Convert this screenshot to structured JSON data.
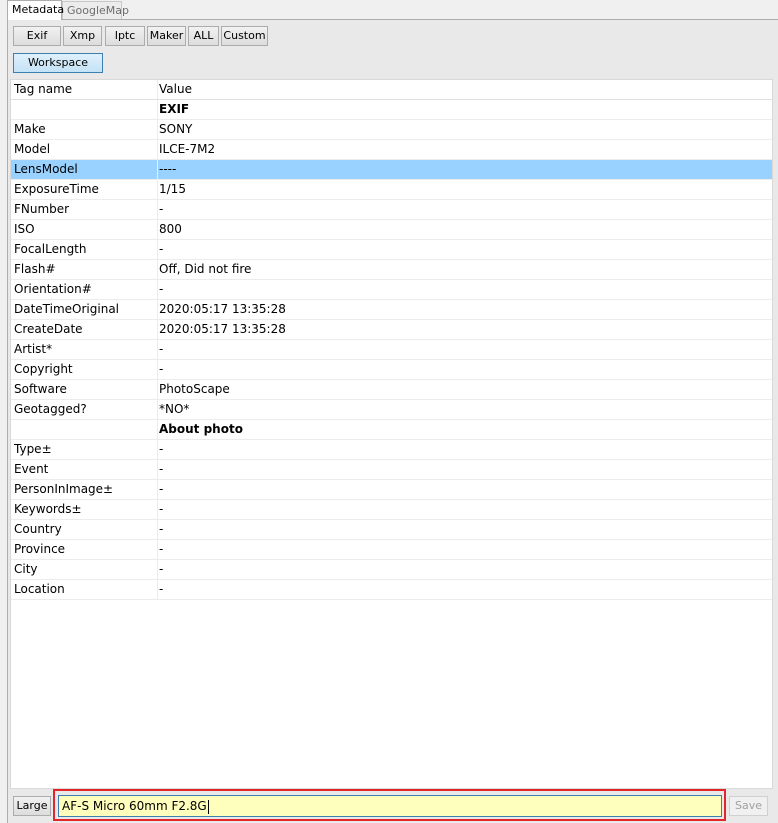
{
  "tabs": [
    {
      "label": "Metadata",
      "active": true
    },
    {
      "label": "GoogleMap",
      "active": false
    }
  ],
  "toolbar": {
    "buttons": [
      "Exif",
      "Xmp",
      "Iptc",
      "Maker",
      "ALL",
      "Custom"
    ],
    "workspace": "Workspace"
  },
  "grid": {
    "columns": [
      "Tag name",
      "Value"
    ],
    "rows": [
      {
        "tag": "",
        "value": "EXIF",
        "section": true
      },
      {
        "tag": "Make",
        "value": "SONY"
      },
      {
        "tag": "Model",
        "value": "ILCE-7M2"
      },
      {
        "tag": "LensModel",
        "value": "----",
        "selected": true
      },
      {
        "tag": "ExposureTime",
        "value": "1/15"
      },
      {
        "tag": "FNumber",
        "value": "-"
      },
      {
        "tag": "ISO",
        "value": "800"
      },
      {
        "tag": "FocalLength",
        "value": "-"
      },
      {
        "tag": "Flash#",
        "value": "Off, Did not fire"
      },
      {
        "tag": "Orientation#",
        "value": "-"
      },
      {
        "tag": "DateTimeOriginal",
        "value": "2020:05:17 13:35:28"
      },
      {
        "tag": "CreateDate",
        "value": "2020:05:17 13:35:28"
      },
      {
        "tag": "Artist*",
        "value": "-"
      },
      {
        "tag": "Copyright",
        "value": "-"
      },
      {
        "tag": "Software",
        "value": "PhotoScape"
      },
      {
        "tag": "Geotagged?",
        "value": "*NO*"
      },
      {
        "tag": "",
        "value": "About photo",
        "section": true
      },
      {
        "tag": "Type±",
        "value": "-"
      },
      {
        "tag": "Event",
        "value": "-"
      },
      {
        "tag": "PersonInImage±",
        "value": "-"
      },
      {
        "tag": "Keywords±",
        "value": "-"
      },
      {
        "tag": "Country",
        "value": "-"
      },
      {
        "tag": "Province",
        "value": "-"
      },
      {
        "tag": "City",
        "value": "-"
      },
      {
        "tag": "Location",
        "value": "-"
      }
    ]
  },
  "footer": {
    "large_label": "Large",
    "edit_value": "AF-S Micro 60mm F2.8G",
    "save_label": "Save"
  },
  "colors": {
    "selected_row": "#99d1ff",
    "edit_background": "#ffffbd",
    "highlight_frame": "#e3262b"
  }
}
